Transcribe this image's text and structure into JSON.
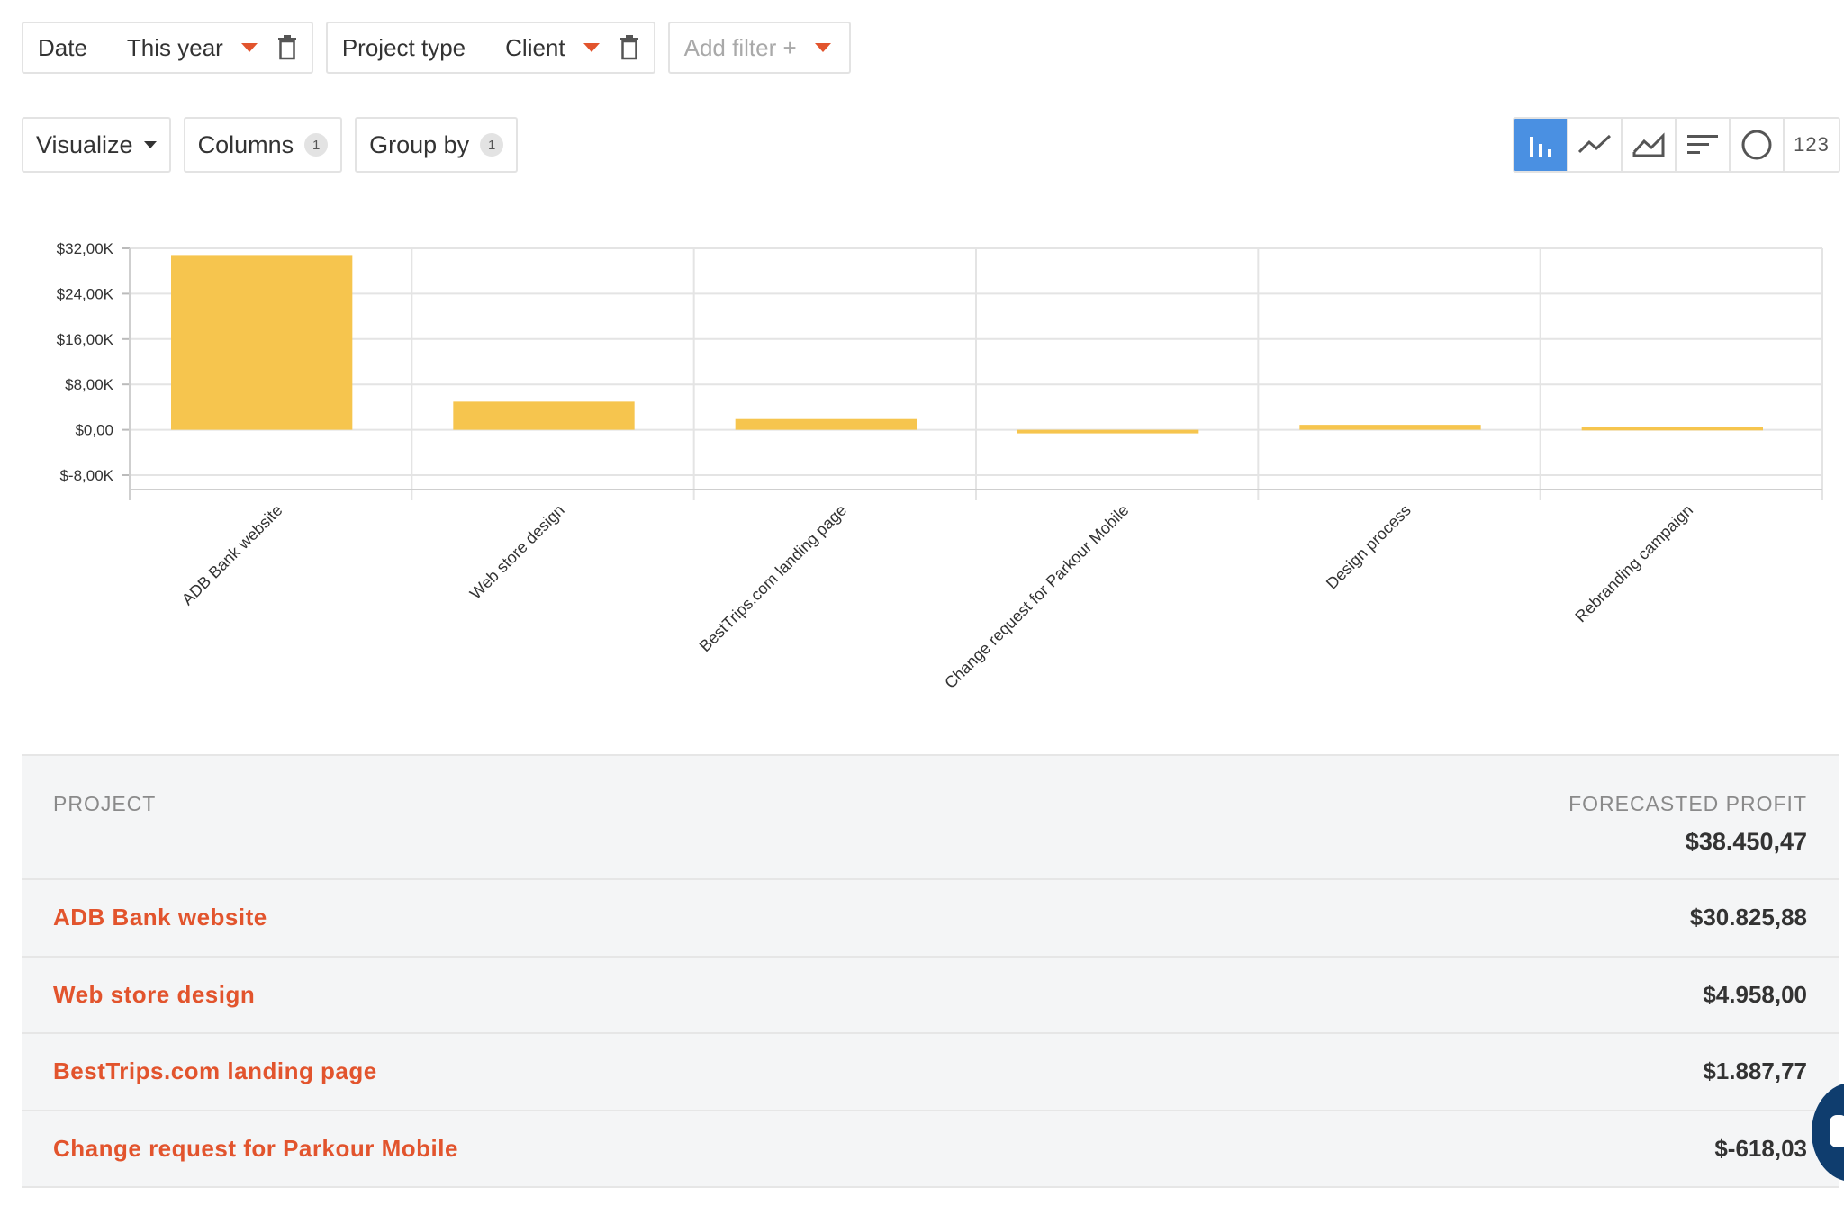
{
  "filters": [
    {
      "label": "Date",
      "value": "This year"
    },
    {
      "label": "Project type",
      "value": "Client"
    }
  ],
  "add_filter": {
    "label": "Add filter +"
  },
  "toolbar": {
    "visualize": "Visualize",
    "columns": "Columns",
    "columns_count": "1",
    "group_by": "Group by",
    "group_by_count": "1"
  },
  "viz_types": {
    "bar": "bar-chart-icon",
    "line": "line-chart-icon",
    "area": "area-chart-icon",
    "sorted": "sorted-bars-icon",
    "pie": "pie-chart-icon",
    "number": "123"
  },
  "colors": {
    "accent": "#e2542d",
    "bar": "#f6c54e",
    "active": "#4a90e2"
  },
  "chart_data": {
    "type": "bar",
    "categories": [
      "ADB Bank website",
      "Web store design",
      "BestTrips.com landing page",
      "Change request for Parkour Mobile",
      "Design process",
      "Rebranding campaign"
    ],
    "values": [
      30825.88,
      4958.0,
      1887.77,
      -618.03,
      870,
      520
    ],
    "yticks": [
      "$32,00K",
      "$24,00K",
      "$16,00K",
      "$8,00K",
      "$0,00",
      "$-8,00K"
    ],
    "ytick_values": [
      32000,
      24000,
      16000,
      8000,
      0,
      -8000
    ],
    "ylim": [
      -8000,
      32000
    ],
    "grid": true
  },
  "table": {
    "col_project": "PROJECT",
    "col_profit": "FORECASTED PROFIT",
    "total": "$38.450,47",
    "rows": [
      {
        "project": "ADB Bank website",
        "profit": "$30.825,88"
      },
      {
        "project": "Web store design",
        "profit": "$4.958,00"
      },
      {
        "project": "BestTrips.com landing page",
        "profit": "$1.887,77"
      },
      {
        "project": "Change request for Parkour Mobile",
        "profit": "$-618,03"
      }
    ]
  }
}
